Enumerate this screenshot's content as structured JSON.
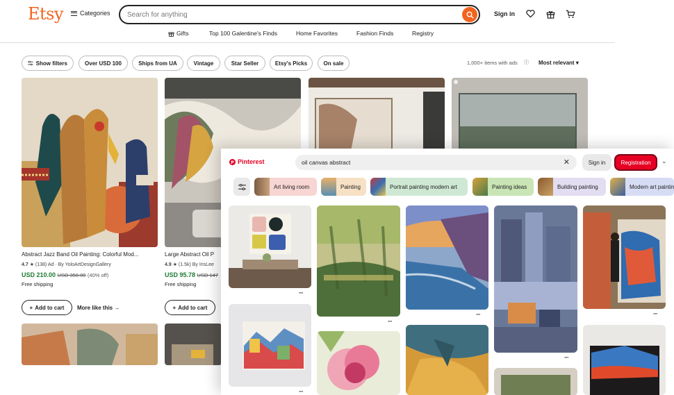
{
  "etsy": {
    "logo": "Etsy",
    "categories": "Categories",
    "search_placeholder": "Search for anything",
    "sign_in": "Sign in",
    "nav": [
      "Gifts",
      "Top 100 Galentine's Finds",
      "Home Favorites",
      "Fashion Finds",
      "Registry"
    ],
    "filters": [
      "Show filters",
      "Over USD 100",
      "Ships from UA",
      "Vintage",
      "Star Seller",
      "Etsy's Picks",
      "On sale"
    ],
    "result_count": "1,000+ items with ads",
    "sort": "Most relevant",
    "products": [
      {
        "title": "Abstract Jazz Band Oil Painting: Colorful Mod...",
        "rating": "4.7",
        "reviews": "(138) Ad · By YoloArtDesignGallery",
        "price": "USD 210.00",
        "old_price": "USD 350.00",
        "discount": "(40% off)",
        "shipping": "Free shipping",
        "cart": "Add to cart",
        "more": "More like this"
      },
      {
        "title": "Large Abstract Oil P",
        "rating": "4.9",
        "reviews": "(1.5k) By IrisLee",
        "price": "USD 95.78",
        "old_price": "USD 147",
        "shipping": "Free shipping",
        "cart": "Add to cart"
      }
    ]
  },
  "pinterest": {
    "logo": "Pinterest",
    "search_value": "oil canvas abstract",
    "sign_in": "Sign in",
    "registration": "Registration",
    "chips": [
      {
        "label": "Art living room",
        "bg": "#f6d5d2"
      },
      {
        "label": "Painting",
        "bg": "#f6e1c5"
      },
      {
        "label": "Portrait painting modern art",
        "bg": "#cfe8d4"
      },
      {
        "label": "Painting ideas",
        "bg": "#c9e5b5"
      },
      {
        "label": "Building painting",
        "bg": "#e3ddf1"
      },
      {
        "label": "Modern art painting",
        "bg": "#d6dcf3"
      }
    ]
  },
  "colors": {
    "etsy_orange": "#f1641e",
    "pinterest_red": "#e60023",
    "price_green": "#1e7a33"
  }
}
